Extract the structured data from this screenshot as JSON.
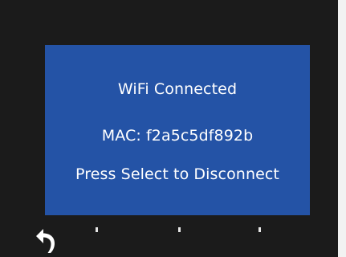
{
  "screen": {
    "title": "WiFi Connected",
    "mac_line": "MAC: f2a5c5df892b",
    "instruction": "Press Select to Disconnect"
  },
  "footer": {
    "back_icon": "back-arrow-icon",
    "indicator_count": 3
  },
  "colors": {
    "bezel": "#1b1b1b",
    "panel": "#2453a6",
    "text": "#ffffff"
  }
}
